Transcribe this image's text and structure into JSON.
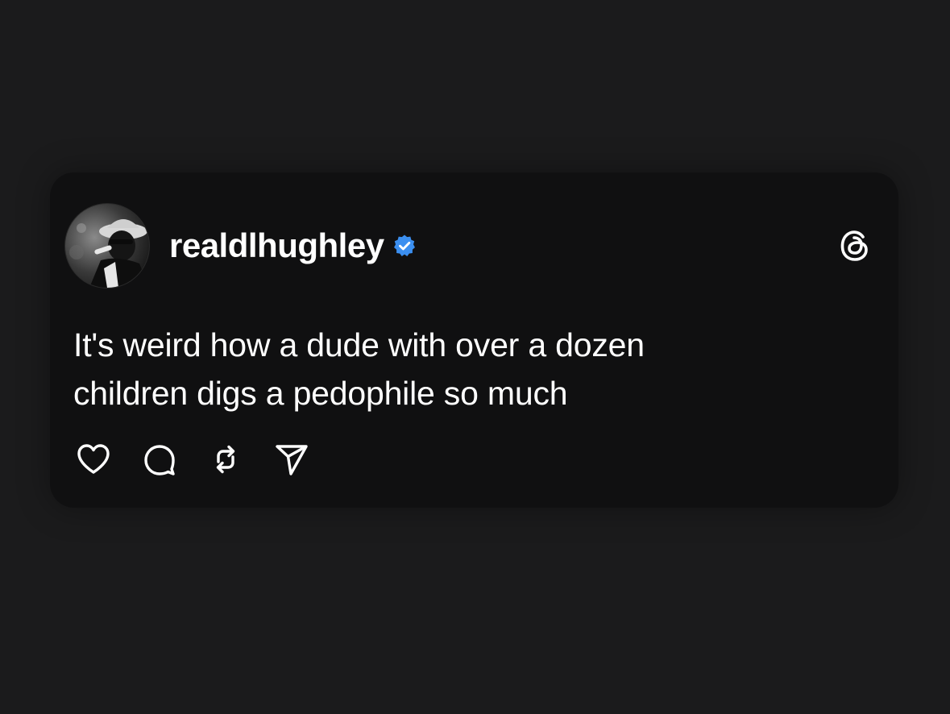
{
  "post": {
    "username": "realdlhughley",
    "verified": true,
    "text_line_1": "It's weird how a dude with over a dozen",
    "text_line_2": "children digs a pedophile so much"
  },
  "icons": {
    "brand": "threads-logo-icon",
    "verified": "verified-badge-icon",
    "actions": [
      "heart-icon",
      "comment-icon",
      "repost-icon",
      "share-icon"
    ]
  },
  "colors": {
    "background": "#1b1b1c",
    "card": "#101011",
    "text": "#ffffff",
    "verified_blue": "#3b8ff0"
  }
}
